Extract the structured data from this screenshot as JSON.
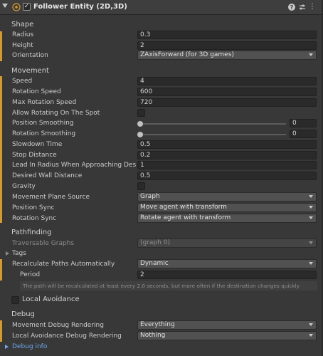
{
  "header": {
    "title": "Follower Entity (2D,3D)",
    "enabled": true,
    "icons": [
      "fold-arrow",
      "component-icon",
      "help-icon",
      "settings-icon",
      "menu-icon"
    ]
  },
  "shape": {
    "section": "Shape",
    "radius_label": "Radius",
    "radius_value": "0.3",
    "height_label": "Height",
    "height_value": "2",
    "orientation_label": "Orientation",
    "orientation_value": "ZAxisForward (for 3D games)"
  },
  "movement": {
    "section": "Movement",
    "speed_label": "Speed",
    "speed_value": "4",
    "rotation_speed_label": "Rotation Speed",
    "rotation_speed_value": "600",
    "max_rotation_speed_label": "Max Rotation Speed",
    "max_rotation_speed_value": "720",
    "allow_rotating_label": "Allow Rotating On The Spot",
    "position_smoothing_label": "Position Smoothing",
    "position_smoothing_value": "0",
    "rotation_smoothing_label": "Rotation Smoothing",
    "rotation_smoothing_value": "0",
    "slowdown_time_label": "Slowdown Time",
    "slowdown_time_value": "0.5",
    "stop_distance_label": "Stop Distance",
    "stop_distance_value": "0.2",
    "lead_in_label": "Lead In Radius When Approaching Destination",
    "lead_in_value": "1",
    "desired_wall_label": "Desired Wall Distance",
    "desired_wall_value": "0.5",
    "gravity_label": "Gravity",
    "plane_source_label": "Movement Plane Source",
    "plane_source_value": "Graph",
    "position_sync_label": "Position Sync",
    "position_sync_value": "Move agent with transform",
    "rotation_sync_label": "Rotation Sync",
    "rotation_sync_value": "Rotate agent with transform"
  },
  "pathfinding": {
    "section": "Pathfinding",
    "traversable_label": "Traversable Graphs",
    "traversable_value": "(graph 0)",
    "tags_label": "Tags",
    "recalc_label": "Recalculate Paths Automatically",
    "recalc_value": "Dynamic",
    "period_label": "Period",
    "period_value": "2",
    "help_text": "The path will be recalculated at least every 2.0 seconds, but more often if the destination changes quickly"
  },
  "local_avoidance": {
    "label": "Local Avoidance"
  },
  "debug": {
    "section": "Debug",
    "movement_label": "Movement Debug Rendering",
    "movement_value": "Everything",
    "avoidance_label": "Local Avoidance Debug Rendering",
    "avoidance_value": "Nothing",
    "info_label": "Debug info"
  },
  "colors": {
    "accent": "#d79a2a",
    "link": "#6aa9ee",
    "background": "#383838"
  }
}
